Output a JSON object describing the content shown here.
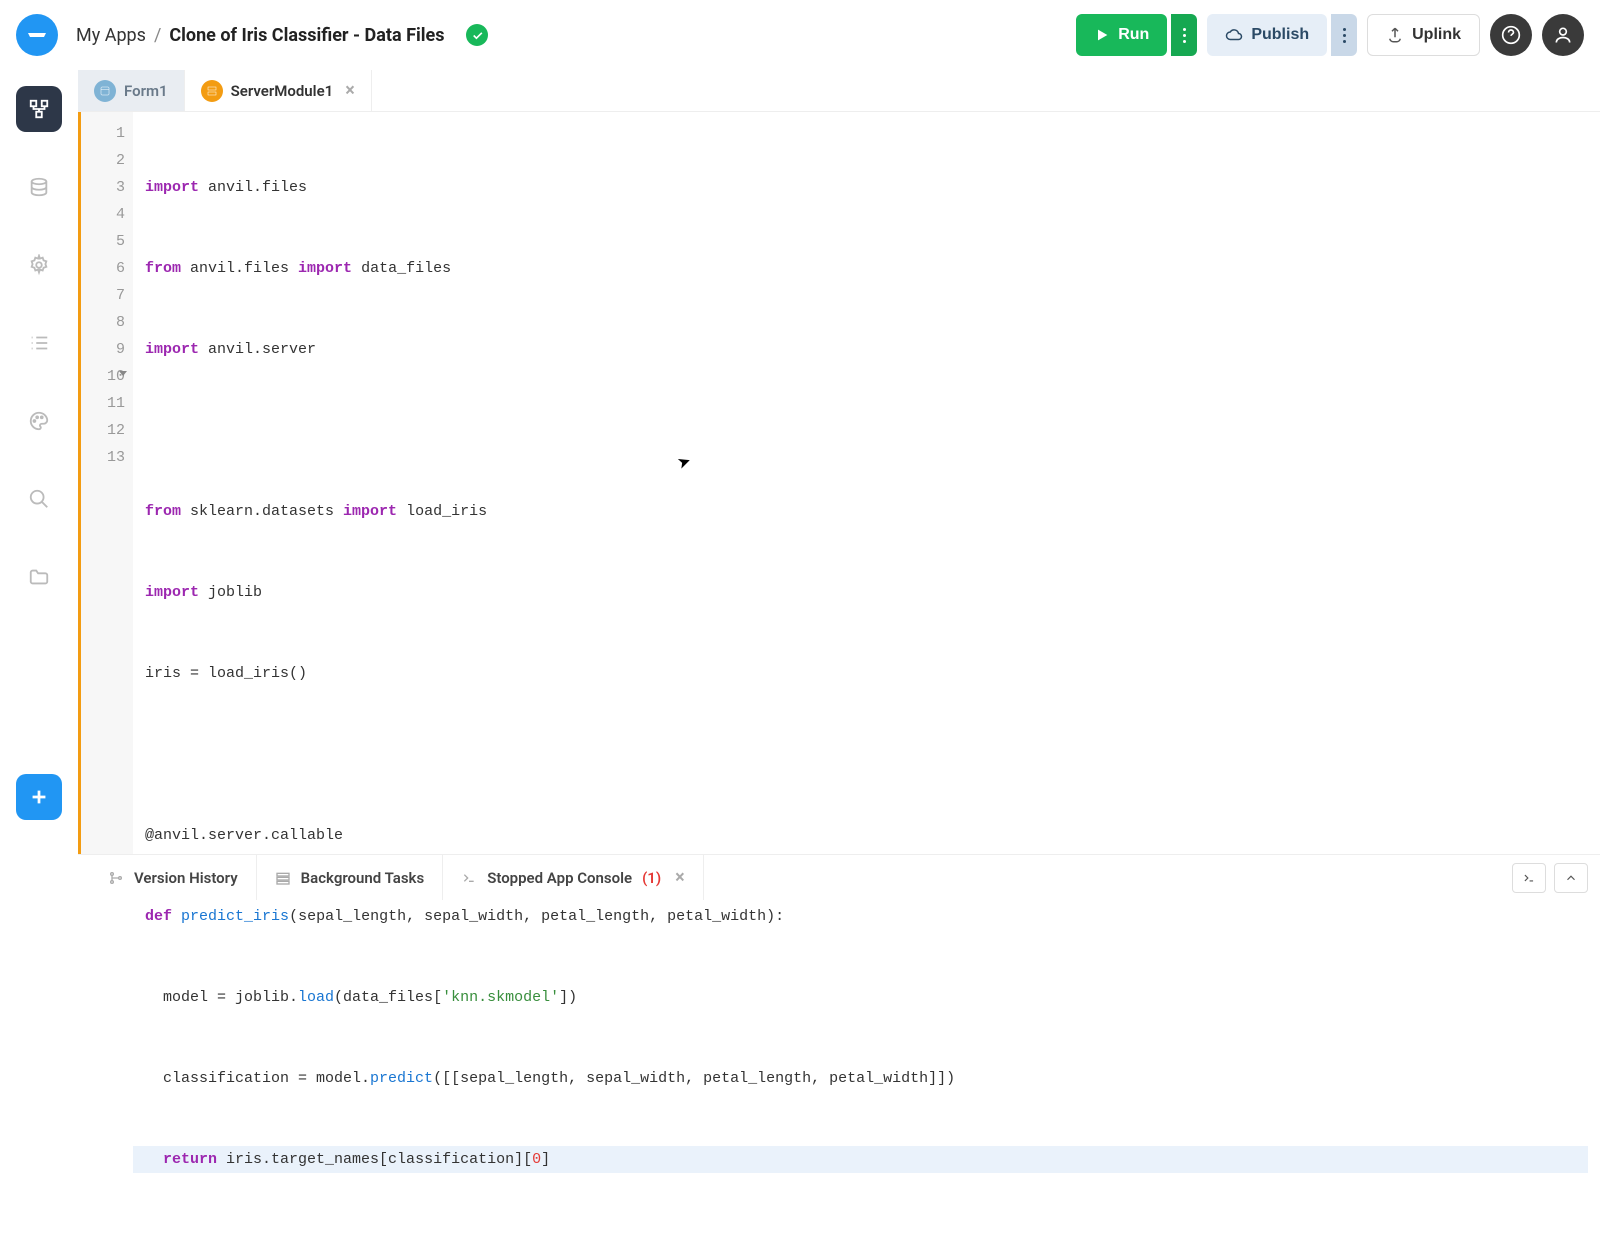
{
  "breadcrumb": {
    "apps": "My Apps",
    "sep": "/",
    "name": "Clone of Iris Classifier - Data Files"
  },
  "toolbar": {
    "run": "Run",
    "publish": "Publish",
    "uplink": "Uplink"
  },
  "tabs": {
    "form": "Form1",
    "server": "ServerModule1"
  },
  "code": {
    "lines": [
      "1",
      "2",
      "3",
      "4",
      "5",
      "6",
      "7",
      "8",
      "9",
      "10",
      "11",
      "12",
      "13"
    ],
    "l1_kw": "import",
    "l1_rest": " anvil.files",
    "l2_kw1": "from",
    "l2_mid": " anvil.files ",
    "l2_kw2": "import",
    "l2_rest": " data_files",
    "l3_kw": "import",
    "l3_rest": " anvil.server",
    "l5_kw1": "from",
    "l5_mid": " sklearn.datasets ",
    "l5_kw2": "import",
    "l5_rest": " load_iris",
    "l6_kw": "import",
    "l6_rest": " joblib",
    "l7": "iris = load_iris()",
    "l9": "@anvil.server.callable",
    "l10_kw": "def",
    "l10_sp": " ",
    "l10_fn": "predict_iris",
    "l10_args": "(sepal_length, sepal_width, petal_length, petal_width):",
    "l11_pre": "  model = joblib.",
    "l11_fn": "load",
    "l11_a": "(data_files[",
    "l11_str": "'knn.skmodel'",
    "l11_b": "])",
    "l12_pre": "  classification = model.",
    "l12_fn": "predict",
    "l12_args": "([[sepal_length, sepal_width, petal_length, petal_width]])",
    "l13_sp": "  ",
    "l13_kw": "return",
    "l13_a": " iris.target_names[classification][",
    "l13_num": "0",
    "l13_b": "]"
  },
  "bottom": {
    "history": "Version History",
    "bg": "Background Tasks",
    "console": "Stopped App Console",
    "console_err": "(1)"
  }
}
